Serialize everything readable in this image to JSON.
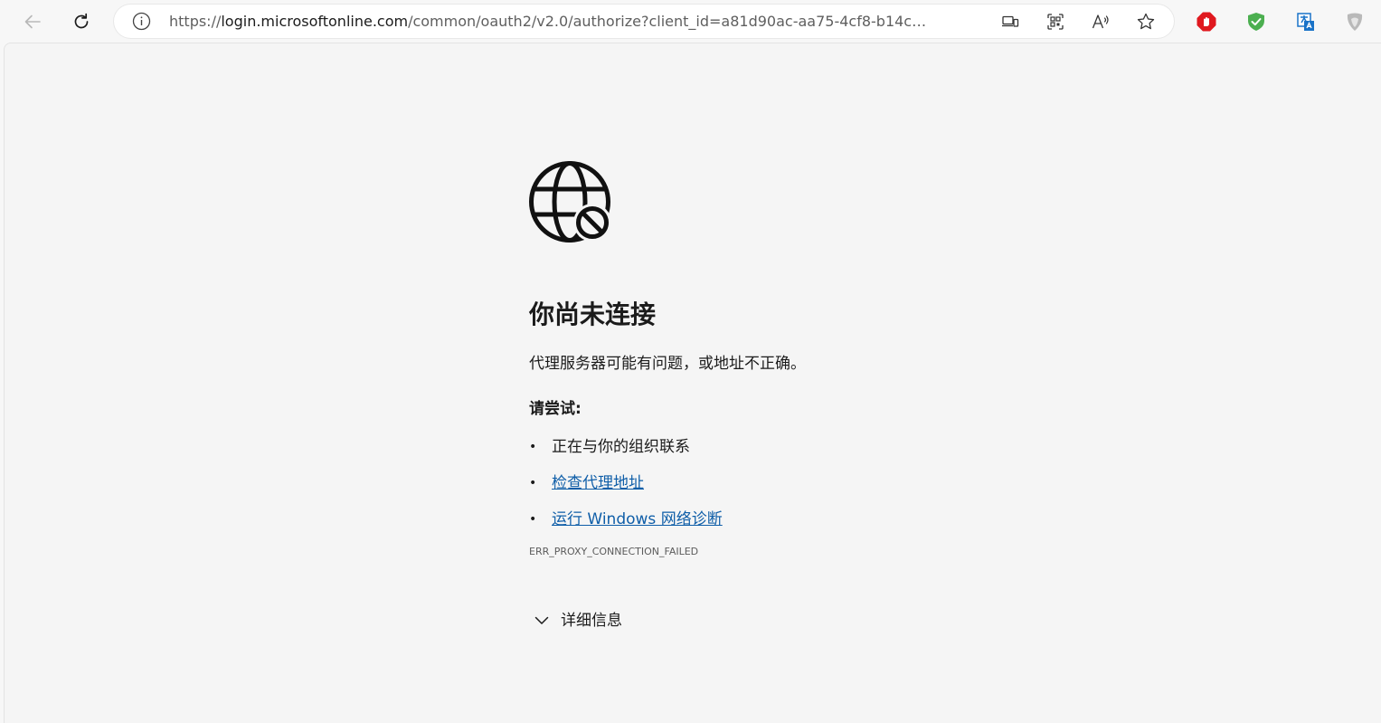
{
  "browser": {
    "url_prefix": "https://",
    "url_host": "login.microsoftonline.com",
    "url_path": "/common/oauth2/v2.0/authorize?client_id=a81d90ac-aa75-4cf8-b14c-58bf34852...",
    "icons": {
      "back": "back-arrow-icon",
      "refresh": "refresh-icon",
      "site_info": "info-icon",
      "app_available": "app-available-icon",
      "qr_code": "qr-code-icon",
      "read_aloud": "read-aloud-icon",
      "favorite": "star-icon"
    },
    "extensions": [
      "adblock-icon",
      "shield-check-icon",
      "translate-icon",
      "profile-ext-icon"
    ]
  },
  "error_page": {
    "icon": "globe-blocked-icon",
    "title": "你尚未连接",
    "description": "代理服务器可能有问题，或地址不正确。",
    "try_label": "请尝试:",
    "suggestions": [
      {
        "text": "正在与你的组织联系",
        "link": false
      },
      {
        "text": "检查代理地址",
        "link": true
      },
      {
        "text": "运行 Windows 网络诊断",
        "link": true
      }
    ],
    "bullet": "•",
    "error_code": "ERR_PROXY_CONNECTION_FAILED",
    "details_label": "详细信息"
  },
  "colors": {
    "page_bg": "#f5f5f5",
    "link": "#0f5ea8",
    "text": "#1b1b1b",
    "adblock_red": "#e0191f",
    "shield_green": "#4caf50",
    "translate_blue": "#1a73c8"
  }
}
